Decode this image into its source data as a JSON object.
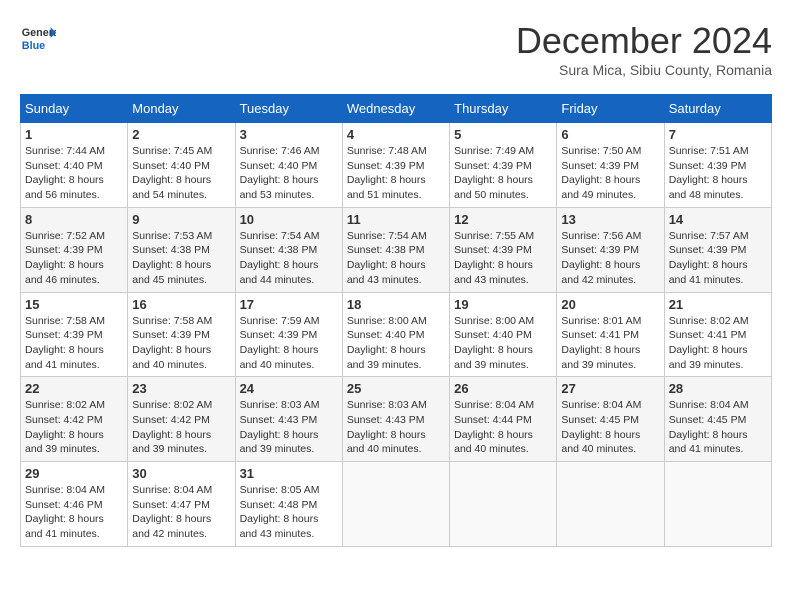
{
  "header": {
    "logo_general": "General",
    "logo_blue": "Blue",
    "month_title": "December 2024",
    "location": "Sura Mica, Sibiu County, Romania"
  },
  "weekdays": [
    "Sunday",
    "Monday",
    "Tuesday",
    "Wednesday",
    "Thursday",
    "Friday",
    "Saturday"
  ],
  "weeks": [
    [
      {
        "day": "1",
        "sunrise": "7:44 AM",
        "sunset": "4:40 PM",
        "daylight": "8 hours and 56 minutes."
      },
      {
        "day": "2",
        "sunrise": "7:45 AM",
        "sunset": "4:40 PM",
        "daylight": "8 hours and 54 minutes."
      },
      {
        "day": "3",
        "sunrise": "7:46 AM",
        "sunset": "4:40 PM",
        "daylight": "8 hours and 53 minutes."
      },
      {
        "day": "4",
        "sunrise": "7:48 AM",
        "sunset": "4:39 PM",
        "daylight": "8 hours and 51 minutes."
      },
      {
        "day": "5",
        "sunrise": "7:49 AM",
        "sunset": "4:39 PM",
        "daylight": "8 hours and 50 minutes."
      },
      {
        "day": "6",
        "sunrise": "7:50 AM",
        "sunset": "4:39 PM",
        "daylight": "8 hours and 49 minutes."
      },
      {
        "day": "7",
        "sunrise": "7:51 AM",
        "sunset": "4:39 PM",
        "daylight": "8 hours and 48 minutes."
      }
    ],
    [
      {
        "day": "8",
        "sunrise": "7:52 AM",
        "sunset": "4:39 PM",
        "daylight": "8 hours and 46 minutes."
      },
      {
        "day": "9",
        "sunrise": "7:53 AM",
        "sunset": "4:38 PM",
        "daylight": "8 hours and 45 minutes."
      },
      {
        "day": "10",
        "sunrise": "7:54 AM",
        "sunset": "4:38 PM",
        "daylight": "8 hours and 44 minutes."
      },
      {
        "day": "11",
        "sunrise": "7:54 AM",
        "sunset": "4:38 PM",
        "daylight": "8 hours and 43 minutes."
      },
      {
        "day": "12",
        "sunrise": "7:55 AM",
        "sunset": "4:39 PM",
        "daylight": "8 hours and 43 minutes."
      },
      {
        "day": "13",
        "sunrise": "7:56 AM",
        "sunset": "4:39 PM",
        "daylight": "8 hours and 42 minutes."
      },
      {
        "day": "14",
        "sunrise": "7:57 AM",
        "sunset": "4:39 PM",
        "daylight": "8 hours and 41 minutes."
      }
    ],
    [
      {
        "day": "15",
        "sunrise": "7:58 AM",
        "sunset": "4:39 PM",
        "daylight": "8 hours and 41 minutes."
      },
      {
        "day": "16",
        "sunrise": "7:58 AM",
        "sunset": "4:39 PM",
        "daylight": "8 hours and 40 minutes."
      },
      {
        "day": "17",
        "sunrise": "7:59 AM",
        "sunset": "4:39 PM",
        "daylight": "8 hours and 40 minutes."
      },
      {
        "day": "18",
        "sunrise": "8:00 AM",
        "sunset": "4:40 PM",
        "daylight": "8 hours and 39 minutes."
      },
      {
        "day": "19",
        "sunrise": "8:00 AM",
        "sunset": "4:40 PM",
        "daylight": "8 hours and 39 minutes."
      },
      {
        "day": "20",
        "sunrise": "8:01 AM",
        "sunset": "4:41 PM",
        "daylight": "8 hours and 39 minutes."
      },
      {
        "day": "21",
        "sunrise": "8:02 AM",
        "sunset": "4:41 PM",
        "daylight": "8 hours and 39 minutes."
      }
    ],
    [
      {
        "day": "22",
        "sunrise": "8:02 AM",
        "sunset": "4:42 PM",
        "daylight": "8 hours and 39 minutes."
      },
      {
        "day": "23",
        "sunrise": "8:02 AM",
        "sunset": "4:42 PM",
        "daylight": "8 hours and 39 minutes."
      },
      {
        "day": "24",
        "sunrise": "8:03 AM",
        "sunset": "4:43 PM",
        "daylight": "8 hours and 39 minutes."
      },
      {
        "day": "25",
        "sunrise": "8:03 AM",
        "sunset": "4:43 PM",
        "daylight": "8 hours and 40 minutes."
      },
      {
        "day": "26",
        "sunrise": "8:04 AM",
        "sunset": "4:44 PM",
        "daylight": "8 hours and 40 minutes."
      },
      {
        "day": "27",
        "sunrise": "8:04 AM",
        "sunset": "4:45 PM",
        "daylight": "8 hours and 40 minutes."
      },
      {
        "day": "28",
        "sunrise": "8:04 AM",
        "sunset": "4:45 PM",
        "daylight": "8 hours and 41 minutes."
      }
    ],
    [
      {
        "day": "29",
        "sunrise": "8:04 AM",
        "sunset": "4:46 PM",
        "daylight": "8 hours and 41 minutes."
      },
      {
        "day": "30",
        "sunrise": "8:04 AM",
        "sunset": "4:47 PM",
        "daylight": "8 hours and 42 minutes."
      },
      {
        "day": "31",
        "sunrise": "8:05 AM",
        "sunset": "4:48 PM",
        "daylight": "8 hours and 43 minutes."
      },
      null,
      null,
      null,
      null
    ]
  ]
}
